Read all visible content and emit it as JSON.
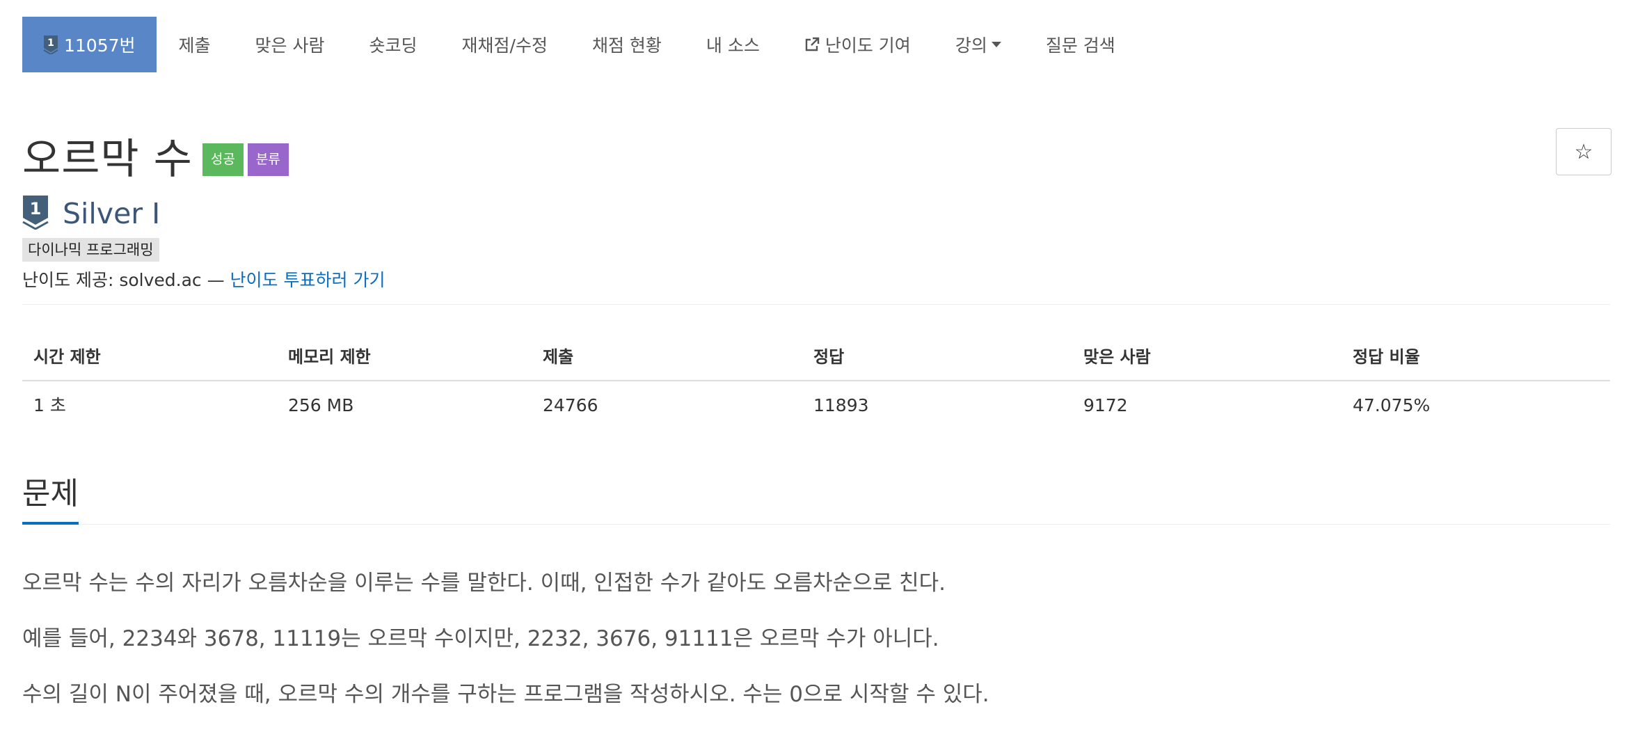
{
  "nav": {
    "items": [
      {
        "label": "11057번",
        "icon": "silver-1-tier-icon",
        "active": true
      },
      {
        "label": "제출"
      },
      {
        "label": "맞은 사람"
      },
      {
        "label": "숏코딩"
      },
      {
        "label": "재채점/수정"
      },
      {
        "label": "채점 현황"
      },
      {
        "label": "내 소스"
      },
      {
        "label": "난이도 기여",
        "icon": "external-link-icon"
      },
      {
        "label": "강의",
        "icon": "caret-down-icon"
      },
      {
        "label": "질문 검색"
      }
    ]
  },
  "problem": {
    "title": "오르막 수",
    "badges": {
      "success": "성공",
      "category": "분류"
    },
    "tier_label": "Silver I",
    "tier_number": "1",
    "tag": "다이나믹 프로그래밍",
    "provider_text": "난이도 제공: solved.ac — ",
    "vote_link": "난이도 투표하러 가기"
  },
  "stats": {
    "headers": [
      "시간 제한",
      "메모리 제한",
      "제출",
      "정답",
      "맞은 사람",
      "정답 비율"
    ],
    "values": [
      "1 초",
      "256 MB",
      "24766",
      "11893",
      "9172",
      "47.075%"
    ]
  },
  "section": {
    "title": "문제"
  },
  "description": [
    "오르막 수는 수의 자리가 오름차순을 이루는 수를 말한다. 이때, 인접한 수가 같아도 오름차순으로 친다.",
    "예를 들어, 2234와 3678, 11119는 오르막 수이지만, 2232, 3676, 91111은 오르막 수가 아니다.",
    "수의 길이 N이 주어졌을 때, 오르막 수의 개수를 구하는 프로그램을 작성하시오. 수는 0으로 시작할 수 있다."
  ],
  "star_icon": "star-outline-icon",
  "colors": {
    "nav_active": "#5886c7",
    "success": "#5cb85c",
    "category": "#9966cc",
    "link": "#0b6dbf",
    "tier": "#3c5677"
  }
}
